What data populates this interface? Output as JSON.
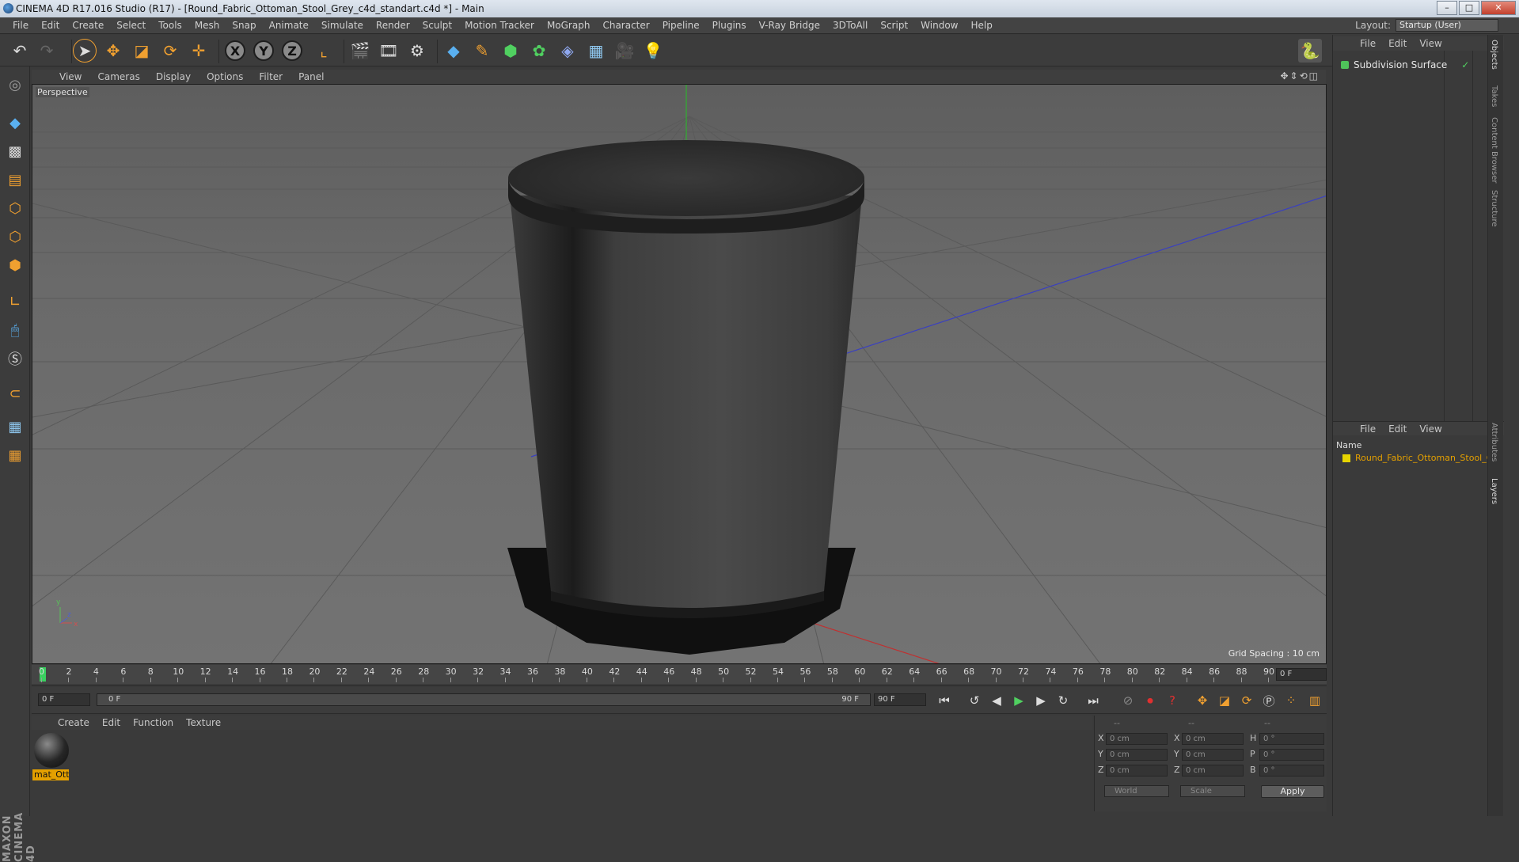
{
  "window": {
    "title": "CINEMA 4D R17.016 Studio (R17) - [Round_Fabric_Ottoman_Stool_Grey_c4d_standart.c4d *] - Main",
    "controls": [
      "–",
      "□",
      "✕"
    ]
  },
  "menubar": {
    "items": [
      "File",
      "Edit",
      "Create",
      "Select",
      "Tools",
      "Mesh",
      "Snap",
      "Animate",
      "Simulate",
      "Render",
      "Sculpt",
      "Motion Tracker",
      "MoGraph",
      "Character",
      "Pipeline",
      "Plugins",
      "V-Ray Bridge",
      "3DToAll",
      "Script",
      "Window",
      "Help"
    ],
    "layout_label": "Layout:",
    "layout_value": "Startup (User)"
  },
  "toolbar": {
    "axis_x": "X",
    "axis_y": "Y",
    "axis_z": "Z"
  },
  "viewport": {
    "menu": [
      "View",
      "Cameras",
      "Display",
      "Options",
      "Filter",
      "Panel"
    ],
    "label": "Perspective",
    "grid_spacing": "Grid Spacing : 10 cm",
    "axis_y": "y",
    "axis_x": "x",
    "axis_z": "z"
  },
  "timeline": {
    "ticks": [
      "0",
      "2",
      "4",
      "6",
      "8",
      "10",
      "12",
      "14",
      "16",
      "18",
      "20",
      "22",
      "24",
      "26",
      "28",
      "30",
      "32",
      "34",
      "36",
      "38",
      "40",
      "42",
      "44",
      "46",
      "48",
      "50",
      "52",
      "54",
      "56",
      "58",
      "60",
      "62",
      "64",
      "66",
      "68",
      "70",
      "72",
      "74",
      "76",
      "78",
      "80",
      "82",
      "84",
      "86",
      "88",
      "90"
    ],
    "current_frame": "0 F"
  },
  "transport": {
    "start_field": "0 F",
    "range_start": "0 F",
    "range_end": "90 F",
    "end_field": "90 F"
  },
  "materials": {
    "menu": [
      "Create",
      "Edit",
      "Function",
      "Texture"
    ],
    "items": [
      {
        "name": "mat_Ott"
      }
    ]
  },
  "coordinates": {
    "header": [
      "--",
      "--",
      "--"
    ],
    "rows": [
      {
        "pos_label": "X",
        "pos_value": "0 cm",
        "size_label": "X",
        "size_value": "0 cm",
        "rot_label": "H",
        "rot_value": "0 °"
      },
      {
        "pos_label": "Y",
        "pos_value": "0 cm",
        "size_label": "Y",
        "size_value": "0 cm",
        "rot_label": "P",
        "rot_value": "0 °"
      },
      {
        "pos_label": "Z",
        "pos_value": "0 cm",
        "size_label": "Z",
        "size_value": "0 cm",
        "rot_label": "B",
        "rot_value": "0 °"
      }
    ],
    "mode_dropdown": "World",
    "size_dropdown": "Scale",
    "apply_label": "Apply"
  },
  "objects_panel": {
    "menu": [
      "File",
      "Edit",
      "View"
    ],
    "objects": [
      {
        "name": "Subdivision Surface",
        "color": "#4fc15a"
      }
    ]
  },
  "layers_panel": {
    "menu": [
      "File",
      "Edit",
      "View"
    ],
    "column_name": "Name",
    "layers": [
      {
        "name": "Round_Fabric_Ottoman_Stool_Gr",
        "color": "#e6d400"
      }
    ]
  },
  "side_tabs": [
    "Objects",
    "Takes",
    "Content Browser",
    "Structure",
    "Attributes",
    "Layers"
  ],
  "logo": {
    "text": "MAXON CINEMA 4D"
  },
  "colors": {
    "accent": "#f0a030",
    "selection": "#e4a000",
    "grid_axis_x": "#c03030",
    "grid_axis_y": "#30a030",
    "grid_axis_z": "#3040c0"
  }
}
